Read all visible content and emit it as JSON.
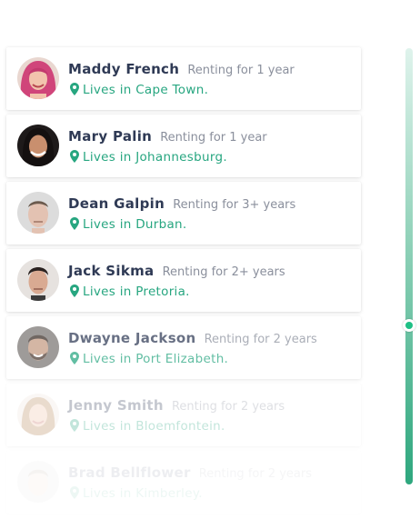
{
  "accent_color": "#27a680",
  "tenants": [
    {
      "name": "Maddy French",
      "rent": "Renting for 1 year",
      "location": "Lives in Cape Town.",
      "avatar": "woman-pink-hair-avatar",
      "opacity": 1.0
    },
    {
      "name": "Mary Palin",
      "rent": "Renting for 1 year",
      "location": "Lives in Johannesburg.",
      "avatar": "woman-dark-hair-avatar",
      "opacity": 1.0
    },
    {
      "name": "Dean Galpin",
      "rent": "Renting for 3+ years",
      "location": "Lives in Durban.",
      "avatar": "man-short-hair-avatar",
      "opacity": 1.0
    },
    {
      "name": "Jack Sikma",
      "rent": "Renting for 2+ years",
      "location": "Lives in Pretoria.",
      "avatar": "man-dark-hair-avatar",
      "opacity": 1.0
    },
    {
      "name": "Dwayne Jackson",
      "rent": "Renting for 2 years",
      "location": "Lives in Port Elizabeth.",
      "avatar": "man-beard-avatar",
      "opacity": 0.72
    },
    {
      "name": "Jenny Smith",
      "rent": "Renting for 2 years",
      "location": "Lives in Bloemfontein.",
      "avatar": "woman-blonde-avatar",
      "opacity": 0.28
    },
    {
      "name": "Brad Bellflower",
      "rent": "Renting for 2 years",
      "location": "Lives in Kimberley.",
      "avatar": "man-fair-avatar",
      "opacity": 0.08
    }
  ],
  "scrollbar": {
    "position": 0.63
  }
}
